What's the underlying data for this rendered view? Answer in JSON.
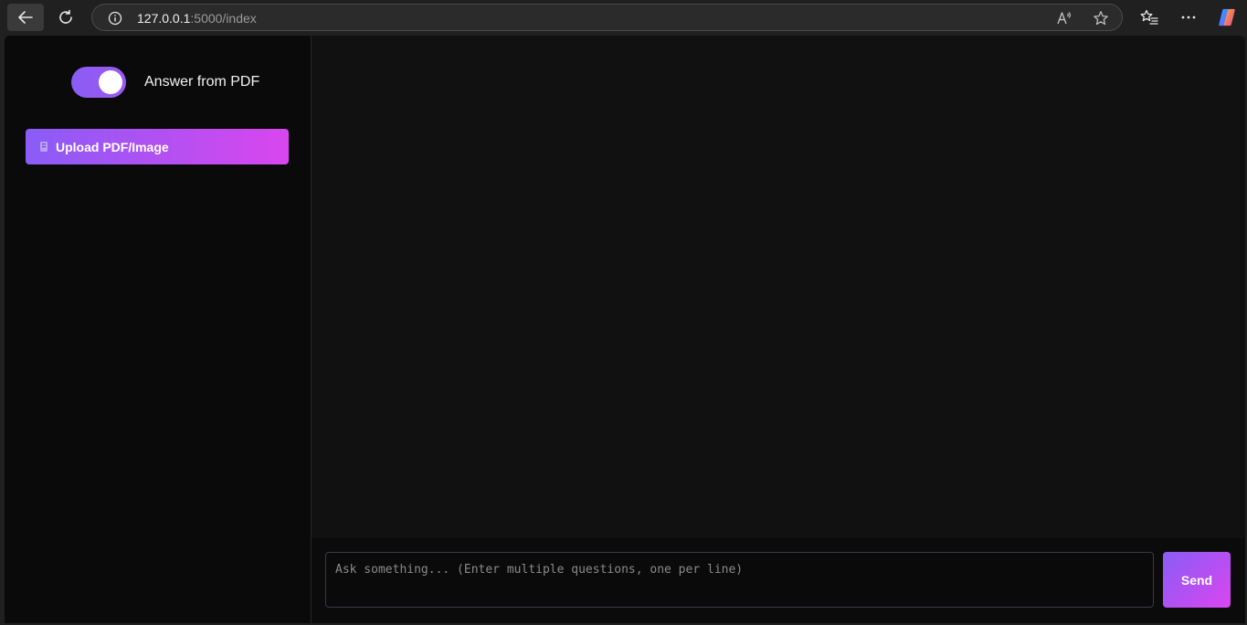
{
  "browser": {
    "url_host": "127.0.0.1",
    "url_path": ":5000/index"
  },
  "sidebar": {
    "toggle_label": "Answer from PDF",
    "toggle_on": true,
    "upload_label": "Upload PDF/Image"
  },
  "input": {
    "placeholder": "Ask something... (Enter multiple questions, one per line)",
    "value": ""
  },
  "send_label": "Send",
  "colors": {
    "accent_start": "#8a5cf6",
    "accent_end": "#d946ef",
    "background": "#0b0b0b"
  },
  "icons": {
    "back": "back-arrow-icon",
    "reload": "reload-icon",
    "info": "info-icon",
    "read_aloud": "read-aloud-icon",
    "favorite": "star-icon",
    "favorites": "favorites-icon",
    "more": "more-icon",
    "copilot": "copilot-icon",
    "upload": "upload-icon"
  }
}
